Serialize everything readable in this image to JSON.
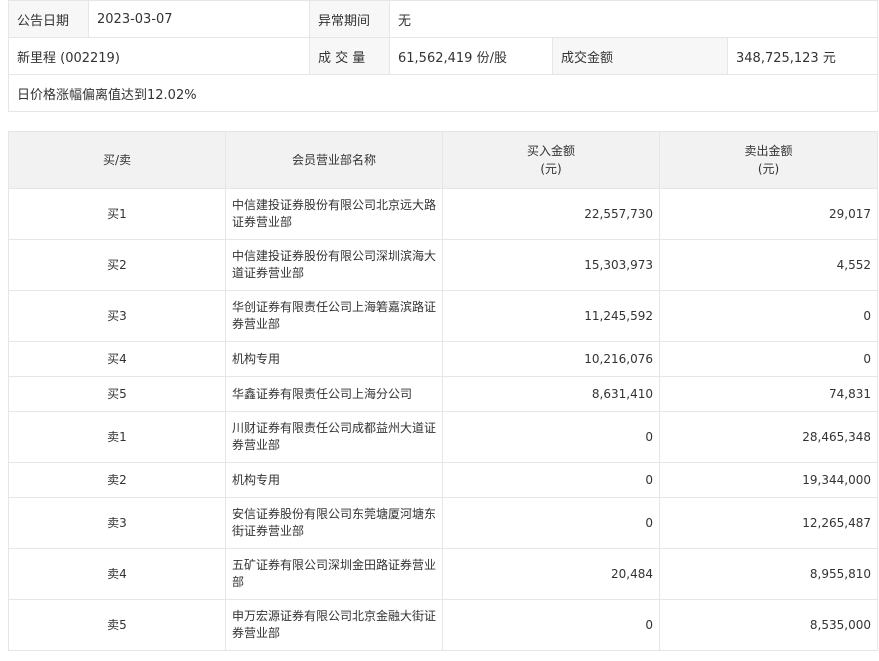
{
  "info": {
    "date_label": "公告日期",
    "date_value": "2023-03-07",
    "period_label": "异常期间",
    "period_value": "无",
    "stock": "新里程 (002219)",
    "volume_label": "成 交 量",
    "volume_value": "61,562,419 份/股",
    "amount_label": "成交金额",
    "amount_value": "348,725,123 元",
    "reason": "日价格涨幅偏离值达到12.02%"
  },
  "table": {
    "headers": {
      "side": "买/卖",
      "dept": "会员营业部名称",
      "buy_line1": "买入金额",
      "buy_line2": "(元)",
      "sell_line1": "卖出金额",
      "sell_line2": "(元)"
    },
    "rows": [
      {
        "side": "买1",
        "dept": "中信建投证券股份有限公司北京远大路证券营业部",
        "buy": "22,557,730",
        "sell": "29,017"
      },
      {
        "side": "买2",
        "dept": "中信建投证券股份有限公司深圳滨海大道证券营业部",
        "buy": "15,303,973",
        "sell": "4,552"
      },
      {
        "side": "买3",
        "dept": "华创证券有限责任公司上海箬嘉滨路证券营业部",
        "buy": "11,245,592",
        "sell": "0"
      },
      {
        "side": "买4",
        "dept": "机构专用",
        "buy": "10,216,076",
        "sell": "0"
      },
      {
        "side": "买5",
        "dept": "华鑫证券有限责任公司上海分公司",
        "buy": "8,631,410",
        "sell": "74,831"
      },
      {
        "side": "卖1",
        "dept": "川财证券有限责任公司成都益州大道证券营业部",
        "buy": "0",
        "sell": "28,465,348"
      },
      {
        "side": "卖2",
        "dept": "机构专用",
        "buy": "0",
        "sell": "19,344,000"
      },
      {
        "side": "卖3",
        "dept": "安信证券股份有限公司东莞塘厦河塘东街证券营业部",
        "buy": "0",
        "sell": "12,265,487"
      },
      {
        "side": "卖4",
        "dept": "五矿证券有限公司深圳金田路证券营业部",
        "buy": "20,484",
        "sell": "8,955,810"
      },
      {
        "side": "卖5",
        "dept": "申万宏源证券有限公司北京金融大街证券营业部",
        "buy": "0",
        "sell": "8,535,000"
      }
    ]
  }
}
